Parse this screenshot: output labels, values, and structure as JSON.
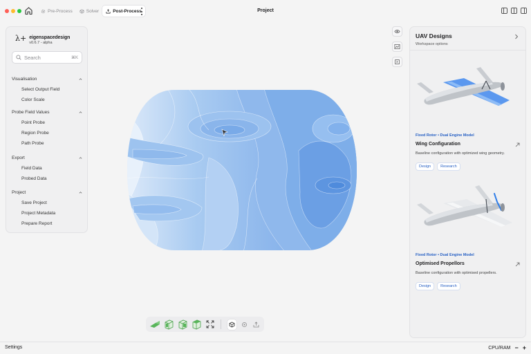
{
  "window": {
    "title": "Project",
    "traffic_colors": [
      "#fe5f57",
      "#febc2e",
      "#28c840"
    ]
  },
  "tabs": [
    {
      "label": "Pre-Process",
      "icon": "gear-icon",
      "active": false
    },
    {
      "label": "Solver",
      "icon": "cube-icon",
      "active": false
    },
    {
      "label": "Post-Process",
      "icon": "export-icon",
      "active": true
    }
  ],
  "brand": {
    "logo": "λ+",
    "name": "eigenspacedesign",
    "version": "v0.6.7 - alpha"
  },
  "search": {
    "placeholder": "Search",
    "shortcut": "⌘K"
  },
  "sidebar": {
    "sections": [
      {
        "title": "Visualisation",
        "items": [
          "Select Output Field",
          "Color Scale"
        ]
      },
      {
        "title": "Probe Field Values",
        "items": [
          "Point Probe",
          "Region Probe",
          "Path Probe"
        ]
      },
      {
        "title": "Export",
        "items": [
          "Field Data",
          "Probed Data"
        ]
      },
      {
        "title": "Project",
        "items": [
          "Save Project",
          "Project Metadata",
          "Prepare Report"
        ]
      }
    ]
  },
  "view_tools": [
    "eye-icon",
    "graph-icon",
    "panel-icon"
  ],
  "bottom_toolbar": [
    "view-iso-icon",
    "view-front-icon",
    "view-top-icon",
    "view-side-icon",
    "fit-view-icon",
    "select-mode-icon",
    "orbit-icon",
    "upload-icon"
  ],
  "right_panel": {
    "title": "UAV Designs",
    "subtitle": "Workspace options",
    "cards": [
      {
        "tag": "Fixed Rotor • Dual Engine Model",
        "title": "Wing Configuration",
        "description": "Baseline configuration with optimized wing geometry.",
        "chips": [
          "Design",
          "Research"
        ],
        "highlight": "#4a8ef0"
      },
      {
        "tag": "Fixed Rotor • Dual Engine Model",
        "title": "Optimised Propellors",
        "description": "Baseline configuration with optimised propellers.",
        "chips": [
          "Design",
          "Research"
        ],
        "highlight": "#2f7de8"
      }
    ]
  },
  "status": {
    "left": "Settings",
    "right": "CPU/RAM",
    "minus": "−",
    "plus": "+"
  },
  "colors": {
    "accent": "#2760c4",
    "field_light": "#c6dcf5",
    "field_mid": "#9ec3ee",
    "field_dark": "#6fa3e6"
  }
}
